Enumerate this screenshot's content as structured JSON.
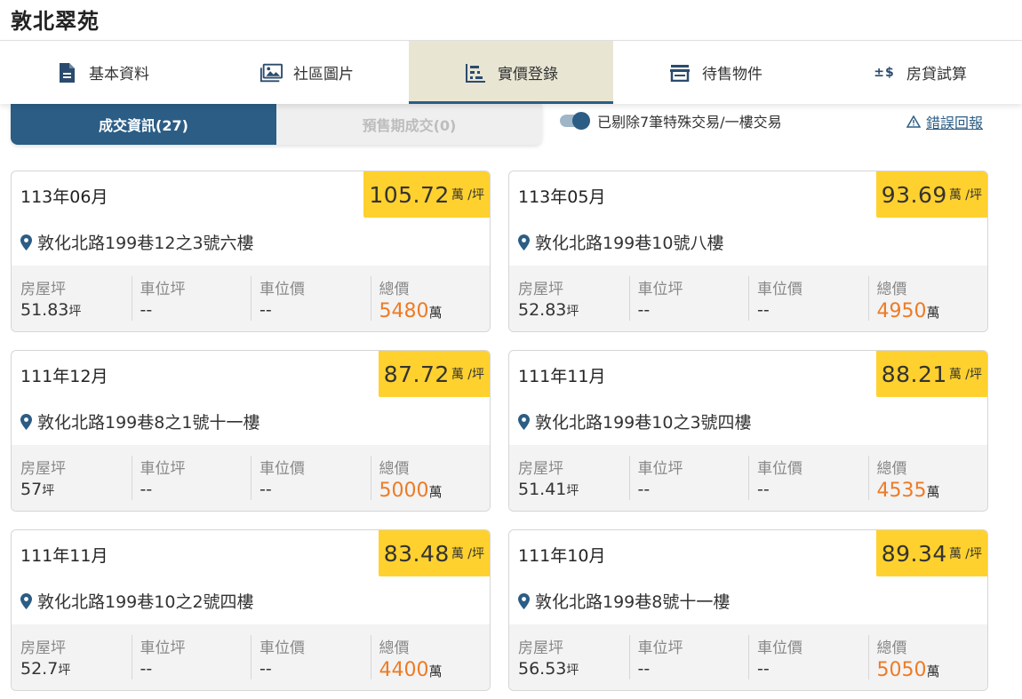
{
  "header": {
    "title": "敦北翠苑"
  },
  "tabs": [
    {
      "label": "基本資料",
      "icon": "document-icon"
    },
    {
      "label": "社區圖片",
      "icon": "image-gallery-icon"
    },
    {
      "label": "實價登錄",
      "icon": "price-chart-icon",
      "active": true
    },
    {
      "label": "待售物件",
      "icon": "storefront-icon"
    },
    {
      "label": "房貸試算",
      "icon": "plus-minus-dollar-icon",
      "icon_text": "±$"
    }
  ],
  "segment": {
    "deal_label": "成交資訊(27)",
    "presale_label": "預售期成交(0)"
  },
  "filter_toggle": {
    "label": "已剔除7筆特殊交易/一樓交易",
    "on": true
  },
  "report_link": {
    "label": "錯誤回報",
    "icon": "warning-triangle-icon"
  },
  "stat_labels": {
    "area": "房屋坪",
    "parking_area": "車位坪",
    "parking_price": "車位價",
    "total": "總價"
  },
  "units": {
    "ping": "坪",
    "wan": "萬",
    "per_ping": "萬 /坪"
  },
  "colors": {
    "accent": "#2b5d85",
    "price_badge": "#ffd12e",
    "total_price": "#ed7b25"
  },
  "cards": [
    {
      "date": "113年06月",
      "unit_price": "105.72",
      "address": "敦化北路199巷12之3號六樓",
      "area": "51.83",
      "parking_area": "--",
      "parking_price": "--",
      "total": "5480"
    },
    {
      "date": "113年05月",
      "unit_price": "93.69",
      "address": "敦化北路199巷10號八樓",
      "area": "52.83",
      "parking_area": "--",
      "parking_price": "--",
      "total": "4950"
    },
    {
      "date": "111年12月",
      "unit_price": "87.72",
      "address": "敦化北路199巷8之1號十一樓",
      "area": "57",
      "parking_area": "--",
      "parking_price": "--",
      "total": "5000"
    },
    {
      "date": "111年11月",
      "unit_price": "88.21",
      "address": "敦化北路199巷10之3號四樓",
      "area": "51.41",
      "parking_area": "--",
      "parking_price": "--",
      "total": "4535"
    },
    {
      "date": "111年11月",
      "unit_price": "83.48",
      "address": "敦化北路199巷10之2號四樓",
      "area": "52.7",
      "parking_area": "--",
      "parking_price": "--",
      "total": "4400"
    },
    {
      "date": "111年10月",
      "unit_price": "89.34",
      "address": "敦化北路199巷8號十一樓",
      "area": "56.53",
      "parking_area": "--",
      "parking_price": "--",
      "total": "5050"
    }
  ]
}
